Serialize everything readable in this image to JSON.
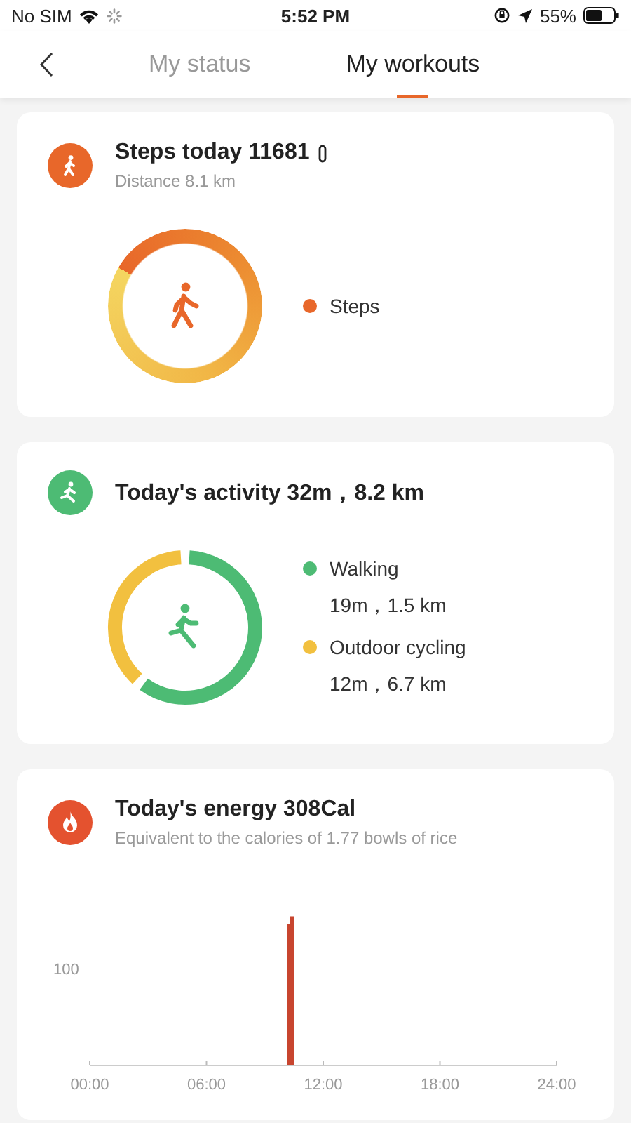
{
  "status_bar": {
    "carrier": "No SIM",
    "time": "5:52 PM",
    "battery": "55%"
  },
  "nav": {
    "tabs": [
      {
        "label": "My status",
        "selected": false
      },
      {
        "label": "My workouts",
        "selected": true
      }
    ]
  },
  "steps_card": {
    "title": "Steps today 11681",
    "subtitle": "Distance 8.1 km",
    "legend": [
      {
        "label": "Steps",
        "color": "#e8672a"
      }
    ]
  },
  "activity_card": {
    "title": "Today's activity 32m，8.2 km",
    "legend": [
      {
        "label": "Walking",
        "detail": "19m，1.5 km",
        "color": "#4dbb74"
      },
      {
        "label": "Outdoor cycling",
        "detail": "12m，6.7 km",
        "color": "#f2c03f"
      }
    ]
  },
  "energy_card": {
    "title": "Today's energy 308Cal",
    "subtitle": "Equivalent to the calories of 1.77 bowls of rice",
    "chart": {
      "y_label": "100",
      "x_labels": [
        "00:00",
        "06:00",
        "12:00",
        "18:00",
        "24:00"
      ]
    }
  }
}
